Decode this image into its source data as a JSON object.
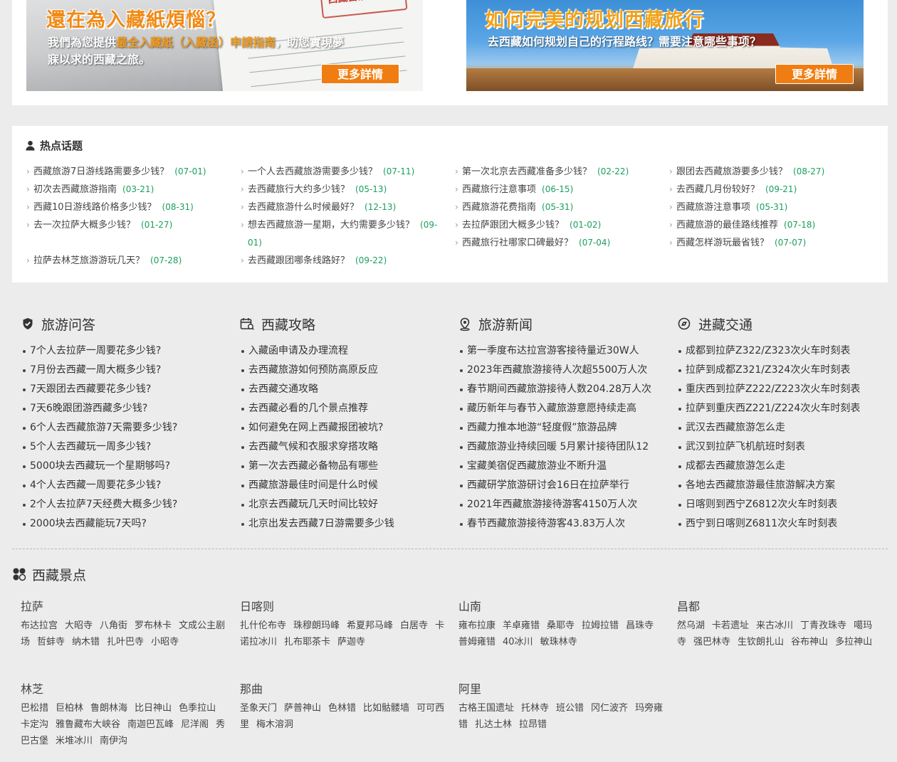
{
  "banners": {
    "left": {
      "title": "還在為入藏紙煩惱？",
      "text_prefix": "我們為您提供",
      "text_highlight": "最全入藏紙（入藏函）申請指南",
      "text_suffix": "，助您實現夢寐以求的西藏之旅。",
      "button": "更多詳情",
      "permit_stamp": "西藏自治区旅游局"
    },
    "right": {
      "title": "如何完美的规划西藏旅行",
      "text": "去西藏如何规划自己的行程路线？需要注意哪些事项？",
      "button": "更多詳情"
    }
  },
  "hot_topics": {
    "title": "热点话题",
    "columns": [
      [
        {
          "text": "西藏旅游7日游线路需要多少钱？",
          "date": "(07-01)"
        },
        {
          "text": "初次去西藏旅游指南",
          "date": "(03-21)"
        },
        {
          "text": "西藏10日游线路价格多少钱？",
          "date": "(08-31)"
        },
        {
          "text": "去一次拉萨大概多少钱？",
          "date": "(01-27)"
        },
        {
          "text": "拉萨去林芝旅游游玩几天？",
          "date": "(07-28)"
        }
      ],
      [
        {
          "text": "一个人去西藏旅游需要多少钱？",
          "date": "(07-11)"
        },
        {
          "text": "去西藏旅行大约多少钱？",
          "date": "(05-13)"
        },
        {
          "text": "去西藏旅游什么时候最好？",
          "date": "(12-13)"
        },
        {
          "text": "想去西藏旅游一星期，大约需要多少钱？",
          "date": "(09-01)"
        },
        {
          "text": "去西藏跟团哪条线路好？",
          "date": "(09-22)"
        }
      ],
      [
        {
          "text": "第一次北京去西藏准备多少钱？",
          "date": "(02-22)"
        },
        {
          "text": "西藏旅行注意事项",
          "date": "(06-15)"
        },
        {
          "text": "西藏旅游花费指南",
          "date": "(05-31)"
        },
        {
          "text": "去拉萨跟团大概多少钱？",
          "date": "(01-02)"
        },
        {
          "text": "西藏旅行社哪家口碑最好？",
          "date": "(07-04)"
        }
      ],
      [
        {
          "text": "跟团去西藏旅游要多少钱？",
          "date": "(08-27)"
        },
        {
          "text": "去西藏几月份较好？",
          "date": "(09-21)"
        },
        {
          "text": "西藏旅游注意事项",
          "date": "(05-31)"
        },
        {
          "text": "西藏旅游的最佳路线推荐",
          "date": "(07-18)"
        },
        {
          "text": "西藏怎样游玩最省钱？",
          "date": "(07-07)"
        }
      ]
    ]
  },
  "sections": [
    {
      "title": "旅游问答",
      "icon": "shield-check-icon",
      "items": [
        "7个人去拉萨一周要花多少钱?",
        "7月份去西藏一周大概多少钱?",
        "7天跟团去西藏要花多少钱?",
        "7天6晚跟团游西藏多少钱?",
        "6个人去西藏旅游7天需要多少钱?",
        "5个人去西藏玩一周多少钱?",
        "5000块去西藏玩一个星期够吗?",
        "4个人去西藏一周要花多少钱?",
        "2个人去拉萨7天经费大概多少钱?",
        "2000块去西藏能玩7天吗?"
      ]
    },
    {
      "title": "西藏攻略",
      "icon": "calendar-guide-icon",
      "items": [
        "入藏函申请及办理流程",
        "去西藏旅游如何预防高原反应",
        "去西藏交通攻略",
        "去西藏必看的几个景点推荐",
        "如何避免在网上西藏报团被坑?",
        "去西藏气候和衣服求穿搭攻略",
        "第一次去西藏必备物品有哪些",
        "西藏旅游最佳时间是什么时候",
        "北京去西藏玩几天时间比较好",
        "北京出发去西藏7日游需要多少钱"
      ]
    },
    {
      "title": "旅游新闻",
      "icon": "location-pin-icon",
      "items": [
        "第一季度布达拉宫游客接待量近30W人",
        "2023年西藏旅游接待人次超5500万人次",
        "春节期间西藏旅游接待人数204.28万人次",
        "藏历新年与春节入藏旅游意愿持续走高",
        "西藏力推本地游“轻度假”旅游品牌",
        "西藏旅游业持续回暖 5月累计接待团队12",
        "宝藏美宿促西藏旅游业不断升温",
        "西藏研学旅游研讨会16日在拉萨举行",
        "2021年西藏旅游接待游客4150万人次",
        "春节西藏旅游接待游客43.83万人次"
      ]
    },
    {
      "title": "进藏交通",
      "icon": "compass-icon",
      "items": [
        "成都到拉萨Z322/Z323次火车时刻表",
        "拉萨到成都Z321/Z324次火车时刻表",
        "重庆西到拉萨Z222/Z223次火车时刻表",
        "拉萨到重庆西Z221/Z224次火车时刻表",
        "武汉去西藏旅游怎么走",
        "武汉到拉萨飞机航班时刻表",
        "成都去西藏旅游怎么走",
        "各地去西藏旅游最佳旅游解决方案",
        "日喀则到西宁Z6812次火车时刻表",
        "西宁到日喀则Z6811次火车时刻表"
      ]
    }
  ],
  "spots": {
    "title": "西藏景点",
    "regions": [
      {
        "name": "拉萨",
        "spots": [
          "布达拉宫",
          "大昭寺",
          "八角街",
          "罗布林卡",
          "文成公主剧场",
          "哲蚌寺",
          "纳木错",
          "扎叶巴寺",
          "小昭寺"
        ]
      },
      {
        "name": "日喀则",
        "spots": [
          "扎什伦布寺",
          "珠穆朗玛峰",
          "希夏邦马峰",
          "白居寺",
          "卡诺拉冰川",
          "扎布耶茶卡",
          "萨迦寺"
        ]
      },
      {
        "name": "山南",
        "spots": [
          "雍布拉康",
          "羊卓雍错",
          "桑耶寺",
          "拉姆拉错",
          "昌珠寺",
          "普姆雍错",
          "40冰川",
          "敏珠林寺"
        ]
      },
      {
        "name": "昌都",
        "spots": [
          "然乌湖",
          "卡若遗址",
          "来古冰川",
          "丁青孜珠寺",
          "噶玛寺",
          "强巴林寺",
          "生钦朗扎山",
          "谷布神山",
          "多拉神山"
        ]
      },
      {
        "name": "林芝",
        "spots": [
          "巴松措",
          "巨柏林",
          "鲁朗林海",
          "比日神山",
          "色季拉山",
          "卡定沟",
          "雅鲁藏布大峡谷",
          "南迦巴瓦峰",
          "尼洋阁",
          "秀巴古堡",
          "米堆冰川",
          "南伊沟"
        ]
      },
      {
        "name": "那曲",
        "spots": [
          "圣象天门",
          "萨普神山",
          "色林错",
          "比如骷髅墙",
          "可可西里",
          "梅木溶洞"
        ]
      },
      {
        "name": "阿里",
        "spots": [
          "古格王国遗址",
          "托林寺",
          "班公错",
          "冈仁波齐",
          "玛旁雍错",
          "扎达土林",
          "拉昂错"
        ]
      }
    ]
  },
  "colors": {
    "date_green": "#1aa05c",
    "button_orange": "#f07d12",
    "title_orange": "#f08a15"
  }
}
